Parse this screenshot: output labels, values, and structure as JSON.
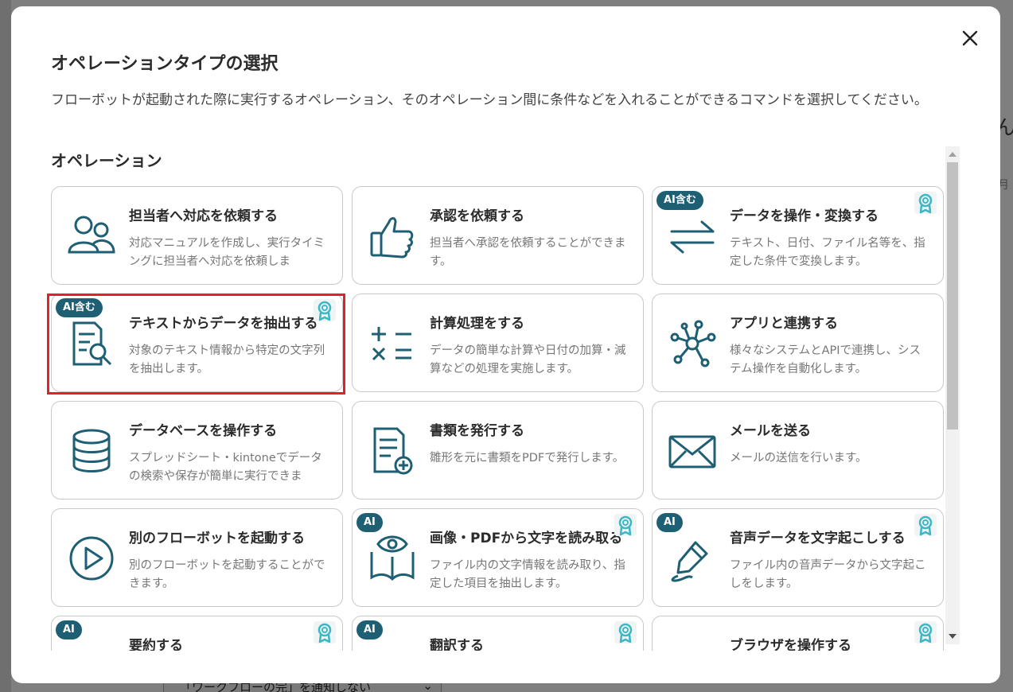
{
  "background": {
    "right_text": "ん",
    "right_text2": "月",
    "bottom_select": "「ワークフローの完」を通知しない"
  },
  "modal": {
    "title": "オペレーションタイプの選択",
    "description": "フローボットが起動された際に実行するオペレーション、そのオペレーション間に条件などを入れることができるコマンドを選択してください。",
    "section_title": "オペレーション",
    "close_icon": "close-icon"
  },
  "cards": [
    {
      "title": "担当者へ対応を依頼する",
      "desc": "対応マニュアルを作成し、実行タイミングに担当者へ対応を依頼しま",
      "badge": "",
      "ribbon": false,
      "icon": "users-icon"
    },
    {
      "title": "承認を依頼する",
      "desc": "担当者へ承認を依頼することができます。",
      "badge": "",
      "ribbon": false,
      "icon": "thumbs-up-icon"
    },
    {
      "title": "データを操作・変換する",
      "desc": "テキスト、日付、ファイル名等を、指定した条件で変換します。",
      "badge": "AI含む",
      "ribbon": true,
      "icon": "transfer-arrows-icon"
    },
    {
      "title": "テキストからデータを抽出する",
      "desc": "対象のテキスト情報から特定の文字列を抽出します。",
      "badge": "AI含む",
      "ribbon": true,
      "icon": "document-search-icon"
    },
    {
      "title": "計算処理をする",
      "desc": "データの簡単な計算や日付の加算・減算などの処理を実施します。",
      "badge": "",
      "ribbon": false,
      "icon": "calculator-icon"
    },
    {
      "title": "アプリと連携する",
      "desc": "様々なシステムとAPIで連携し、システム操作を自動化します。",
      "badge": "",
      "ribbon": false,
      "icon": "network-icon"
    },
    {
      "title": "データベースを操作する",
      "desc": "スプレッドシート・kintoneでデータの検索や保存が簡単に実行できま",
      "badge": "",
      "ribbon": false,
      "icon": "database-icon"
    },
    {
      "title": "書類を発行する",
      "desc": "雛形を元に書類をPDFで発行します。",
      "badge": "",
      "ribbon": false,
      "icon": "document-add-icon"
    },
    {
      "title": "メールを送る",
      "desc": "メールの送信を行います。",
      "badge": "",
      "ribbon": false,
      "icon": "mail-icon"
    },
    {
      "title": "別のフローボットを起動する",
      "desc": "別のフローボットを起動することができます。",
      "badge": "",
      "ribbon": false,
      "icon": "play-icon"
    },
    {
      "title": "画像・PDFから文字を読み取る",
      "desc": "ファイル内の文字情報を読み取り、指定した項目を抽出します。",
      "badge": "AI",
      "ribbon": true,
      "icon": "book-eye-icon"
    },
    {
      "title": "音声データを文字起こしする",
      "desc": "ファイル内の音声データから文字起こしをします。",
      "badge": "AI",
      "ribbon": true,
      "icon": "pen-icon"
    },
    {
      "title": "要約する",
      "desc": "",
      "badge": "AI",
      "ribbon": true,
      "icon": ""
    },
    {
      "title": "翻訳する",
      "desc": "",
      "badge": "AI",
      "ribbon": true,
      "icon": ""
    },
    {
      "title": "ブラウザを操作する",
      "desc": "",
      "badge": "",
      "ribbon": true,
      "icon": ""
    }
  ],
  "colors": {
    "icon": "#1f5f74",
    "badge_bg": "#1f5f74",
    "ribbon": "#3bb8c4",
    "highlight": "#e0202a"
  }
}
